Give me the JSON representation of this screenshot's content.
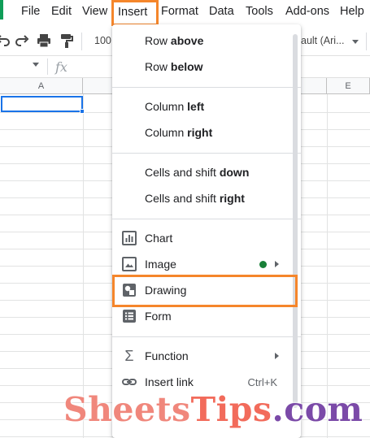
{
  "menubar": {
    "items": [
      "File",
      "Edit",
      "View",
      "Insert",
      "Format",
      "Data",
      "Tools",
      "Add-ons",
      "Help"
    ]
  },
  "toolbar": {
    "zoom": "100",
    "font": "ault (Ari..."
  },
  "formula_bar": {
    "fx": "fx"
  },
  "grid": {
    "column_a": "A",
    "column_e": "E"
  },
  "insert_menu": {
    "row_above": {
      "prefix": "Row ",
      "bold": "above"
    },
    "row_below": {
      "prefix": "Row ",
      "bold": "below"
    },
    "column_left": {
      "prefix": "Column ",
      "bold": "left"
    },
    "column_right": {
      "prefix": "Column ",
      "bold": "right"
    },
    "cells_shift_down": {
      "prefix": "Cells and shift ",
      "bold": "down"
    },
    "cells_shift_right": {
      "prefix": "Cells and shift ",
      "bold": "right"
    },
    "chart": "Chart",
    "image": "Image",
    "drawing": "Drawing",
    "form": "Form",
    "function": "Function",
    "insert_link": "Insert link",
    "insert_link_shortcut": "Ctrl+K"
  },
  "colors": {
    "highlight": "#f5862b",
    "selection": "#1a73e8",
    "new_dot": "#188038"
  },
  "watermark": {
    "part1": "Sheets",
    "part2": "Tips",
    "part3": ".com"
  }
}
